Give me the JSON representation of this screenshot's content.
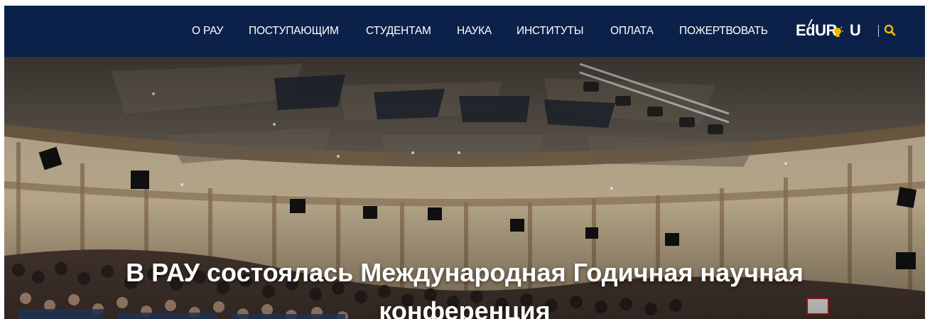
{
  "nav": {
    "items": [
      {
        "label": "О РАУ"
      },
      {
        "label": "ПОСТУПАЮЩИМ"
      },
      {
        "label": "СТУДЕНТАМ"
      },
      {
        "label": "НАУКА"
      },
      {
        "label": "ИНСТИТУТЫ"
      },
      {
        "label": "ОПЛАТА"
      },
      {
        "label": "ПОЖЕРТВОВАТЬ"
      }
    ],
    "logo_text": "EdURAU",
    "search_icon": "search-icon"
  },
  "hero": {
    "title": "В РАУ состоялась Международная Годичная научная конференция"
  },
  "colors": {
    "nav_background": "#0b2149",
    "nav_text": "#ffffff",
    "accent": "#f2b705"
  }
}
